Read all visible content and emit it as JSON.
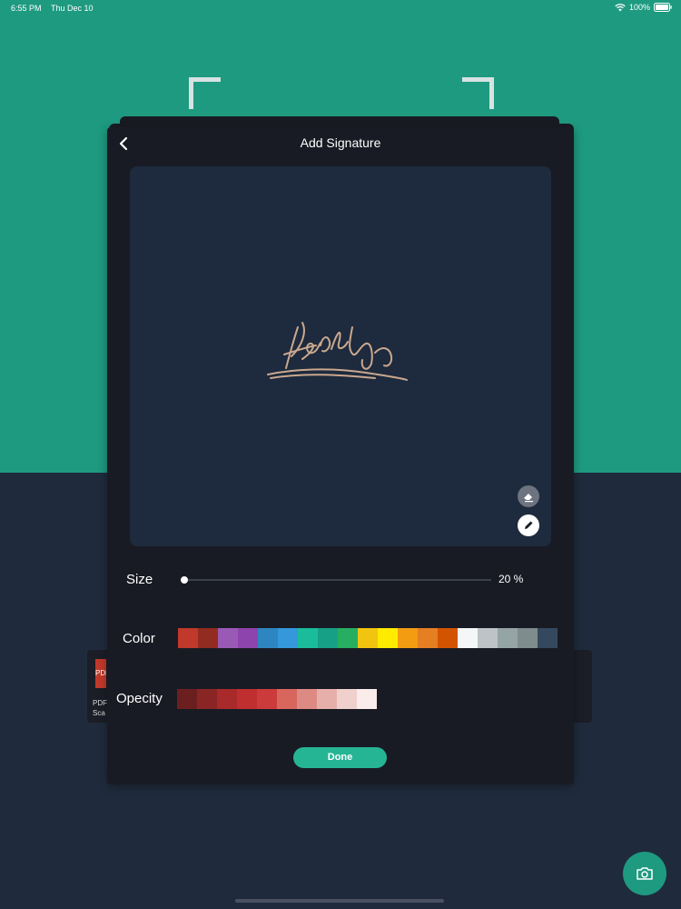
{
  "status_bar": {
    "time": "6:55 PM",
    "date": "Thu Dec 10",
    "battery": "100%"
  },
  "dialog": {
    "title": "Add Signature",
    "back_icon": "chevron-left-icon",
    "eraser_icon": "eraser-icon",
    "pen_icon": "pen-icon"
  },
  "size": {
    "label": "Size",
    "value_text": "20 %",
    "value": 0.2
  },
  "color": {
    "label": "Color",
    "swatches": [
      "#c0392b",
      "#922b21",
      "#9b59b6",
      "#8e44ad",
      "#2e86c1",
      "#3498db",
      "#1abc9c",
      "#16a085",
      "#27ae60",
      "#f1c40f",
      "#ffeb00",
      "#f39c12",
      "#e67e22",
      "#d35400",
      "#f4f6f7",
      "#bdc3c7",
      "#95a5a6",
      "#7f8c8d",
      "#34495e"
    ]
  },
  "opacity": {
    "label": "Opecity",
    "swatches": [
      "#6b1f1f",
      "#8a2525",
      "#a82a2a",
      "#bf2f2f",
      "#cc3b3b",
      "#d9655f",
      "#de8a84",
      "#e6afaa",
      "#efd0cd",
      "#f9ecea"
    ]
  },
  "done_label": "Done",
  "background_card": {
    "thumb_label": "PDF",
    "line1": "PDF",
    "line2": "Sca"
  },
  "fab_icon": "camera-icon",
  "colors": {
    "teal": "#1e9a80",
    "dialog_bg": "#191b24",
    "canvas_bg": "#1e2a3d",
    "signature": "#c9a88f",
    "done_button": "#26b594"
  }
}
